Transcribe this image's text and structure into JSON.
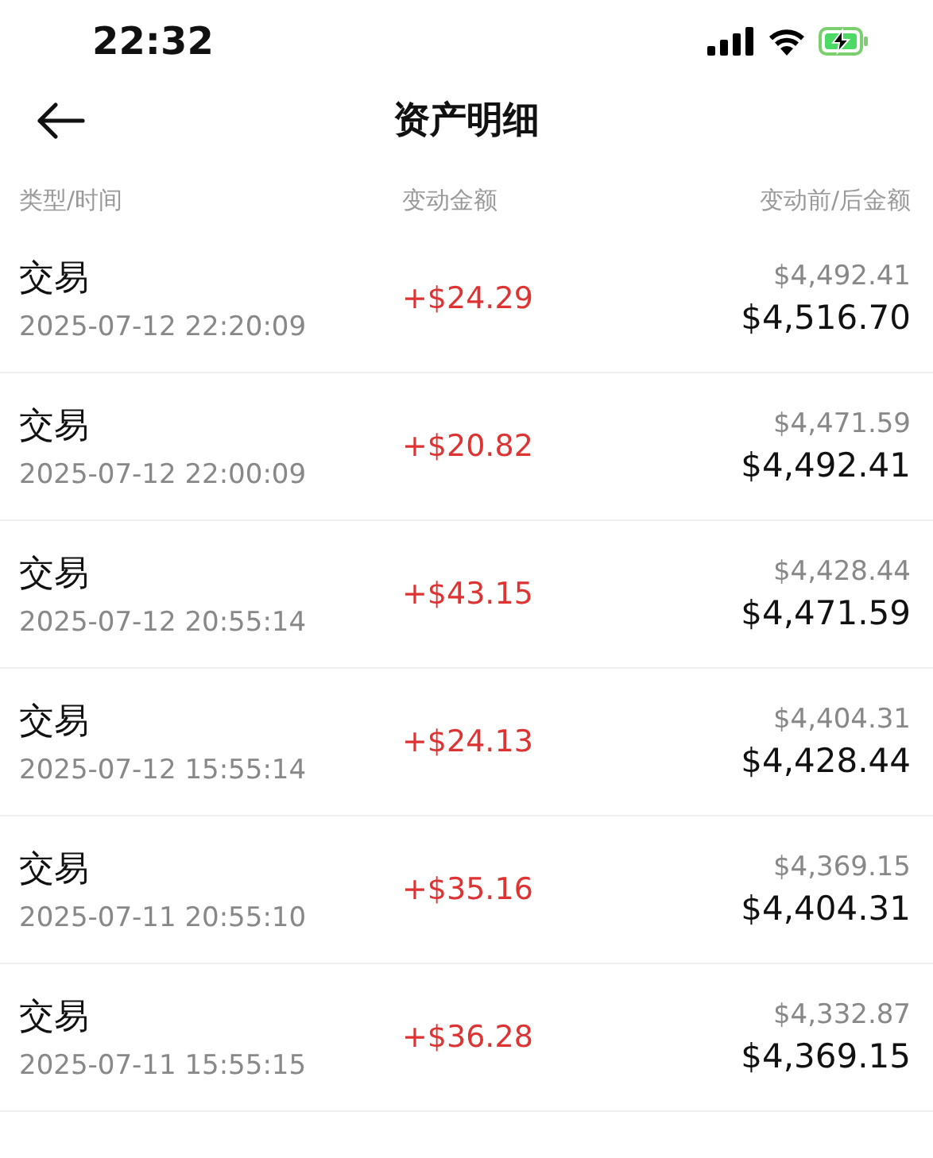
{
  "status_bar": {
    "time": "22:32",
    "battery_charging": true
  },
  "header": {
    "title": "资产明细"
  },
  "columns": [
    "类型/时间",
    "变动金额",
    "变动前/后金额"
  ],
  "rows": [
    {
      "type": "交易",
      "time": "2025-07-12 22:20:09",
      "change": "+$24.29",
      "before": "$4,492.41",
      "after": "$4,516.70"
    },
    {
      "type": "交易",
      "time": "2025-07-12 22:00:09",
      "change": "+$20.82",
      "before": "$4,471.59",
      "after": "$4,492.41"
    },
    {
      "type": "交易",
      "time": "2025-07-12 20:55:14",
      "change": "+$43.15",
      "before": "$4,428.44",
      "after": "$4,471.59"
    },
    {
      "type": "交易",
      "time": "2025-07-12 15:55:14",
      "change": "+$24.13",
      "before": "$4,404.31",
      "after": "$4,428.44"
    },
    {
      "type": "交易",
      "time": "2025-07-11 20:55:10",
      "change": "+$35.16",
      "before": "$4,369.15",
      "after": "$4,404.31"
    },
    {
      "type": "交易",
      "time": "2025-07-11 15:55:15",
      "change": "+$36.28",
      "before": "$4,332.87",
      "after": "$4,369.15"
    }
  ]
}
